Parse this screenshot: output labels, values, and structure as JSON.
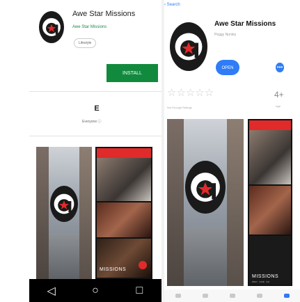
{
  "android": {
    "title": "Awe Star Missions",
    "developer": "Awe Star Missions",
    "category": "Lifestyle",
    "install_label": "INSTALL",
    "rating_icon": "E",
    "rating_label": "Everyone ⓘ",
    "nav": {
      "back": "◁",
      "home": "○",
      "recents": "□"
    }
  },
  "ios": {
    "back_label": "‹ Search",
    "title": "Awe Star Missions",
    "developer": "Peggy Nunley",
    "open_label": "OPEN",
    "more_label": "•••",
    "stars": "☆☆☆☆☆",
    "ratings_note": "Not Enough Ratings",
    "age": "4+",
    "age_label": "Age"
  },
  "screens": {
    "missions_label": "MISSIONS",
    "missions_sub": "PRAY · GIVE · GO"
  },
  "colors": {
    "install_green": "#128a3e",
    "ios_blue": "#2f7cf6",
    "brand_red": "#e12a2a",
    "developer_green": "#1b8a4a"
  }
}
